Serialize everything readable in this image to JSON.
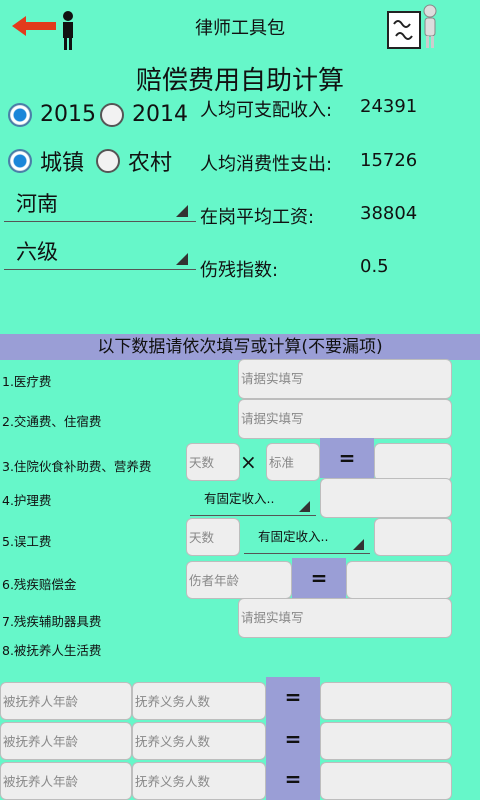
{
  "header": {
    "title": "律师工具包",
    "back_icon": "person-with-red-arrow-icon",
    "logo_icon": "figure-with-sign-logo-icon"
  },
  "main_title": "赔偿费用自助计算",
  "years": [
    {
      "label": "2015",
      "selected": true
    },
    {
      "label": "2014",
      "selected": false
    }
  ],
  "areas": [
    {
      "label": "城镇",
      "selected": true
    },
    {
      "label": "农村",
      "selected": false
    }
  ],
  "province": "河南",
  "disability_level": "六级",
  "stats": [
    {
      "label": "人均可支配收入:",
      "value": "24391"
    },
    {
      "label": "人均消费性支出:",
      "value": "15726"
    },
    {
      "label": "在岗平均工资:",
      "value": "38804"
    },
    {
      "label": "伤残指数:",
      "value": "0.5"
    }
  ],
  "instruction": "以下数据请依次填写或计算(不要漏项)",
  "rows": {
    "medical": {
      "label": "1.医疗费",
      "placeholder": "请据实填写"
    },
    "transport": {
      "label": "2.交通费、住宿费",
      "placeholder": "请据实填写"
    },
    "hospital_food": {
      "label": "3.住院伙食补助费、营养费",
      "days_placeholder": "天数",
      "times": "×",
      "std_placeholder": "标准",
      "eq": "="
    },
    "nursing": {
      "label": "4.护理费",
      "dropdown": "有固定收入.."
    },
    "lost_work": {
      "label": "5.误工费",
      "days_placeholder": "天数",
      "dropdown": "有固定收入.."
    },
    "disability_comp": {
      "label": "6.残疾赔偿金",
      "age_placeholder": "伤者年龄",
      "eq": "="
    },
    "aids": {
      "label": "7.残疾辅助器具费",
      "placeholder": "请据实填写"
    },
    "dependents": {
      "label": "8.被抚养人生活费"
    }
  },
  "dependent_rows": [
    {
      "age_placeholder": "被抚养人年龄",
      "count_placeholder": "抚养义务人数",
      "eq": "="
    },
    {
      "age_placeholder": "被抚养人年龄",
      "count_placeholder": "抚养义务人数",
      "eq": "="
    },
    {
      "age_placeholder": "被抚养人年龄",
      "count_placeholder": "抚养义务人数",
      "eq": "="
    }
  ]
}
